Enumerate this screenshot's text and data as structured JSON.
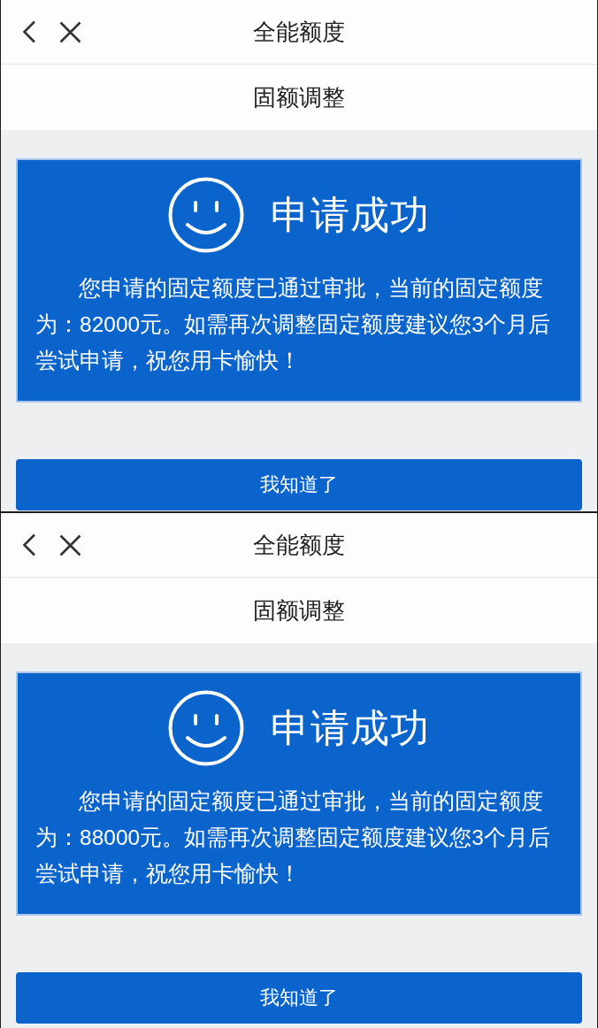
{
  "screens": [
    {
      "nav_bar": {
        "title": "全能额度"
      },
      "subheader": "固额调整",
      "result_card": {
        "title": "申请成功",
        "message": "您申请的固定额度已通过审批，当前的固定额度为：82000元。如需再次调整固定额度建议您3个月后尝试申请，祝您用卡愉快！"
      },
      "button": "我知道了"
    },
    {
      "nav_bar": {
        "title": "全能额度"
      },
      "subheader": "固额调整",
      "result_card": {
        "title": "申请成功",
        "message": "您申请的固定额度已通过审批，当前的固定额度为：88000元。如需再次调整固定额度建议您3个月后尝试申请，祝您用卡愉快！"
      },
      "button": "我知道了"
    }
  ]
}
